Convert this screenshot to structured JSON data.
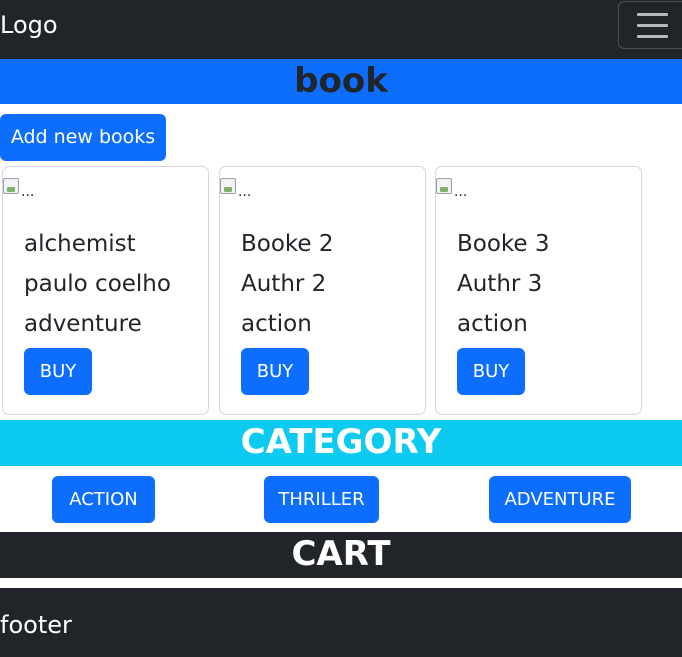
{
  "navbar": {
    "logo": "Logo",
    "toggler_icon": "hamburger-menu-icon"
  },
  "book_section": {
    "title": "book",
    "add_button_label": "Add new books"
  },
  "books": [
    {
      "image_alt": "...",
      "title": "alchemist",
      "author": "paulo coelho",
      "genre": "adventure",
      "buy_label": "BUY"
    },
    {
      "image_alt": "...",
      "title": "Booke 2",
      "author": "Authr 2",
      "genre": "action",
      "buy_label": "BUY"
    },
    {
      "image_alt": "...",
      "title": "Booke 3",
      "author": "Authr 3",
      "genre": "action",
      "buy_label": "BUY"
    }
  ],
  "category_section": {
    "title": "CATEGORY",
    "buttons": [
      "ACTION",
      "THRILLER",
      "ADVENTURE"
    ]
  },
  "cart_section": {
    "title": "CART"
  },
  "footer": {
    "text": "footer"
  },
  "colors": {
    "primary": "#0d6efd",
    "info": "#0dcaf0",
    "dark": "#212529",
    "white": "#ffffff"
  }
}
